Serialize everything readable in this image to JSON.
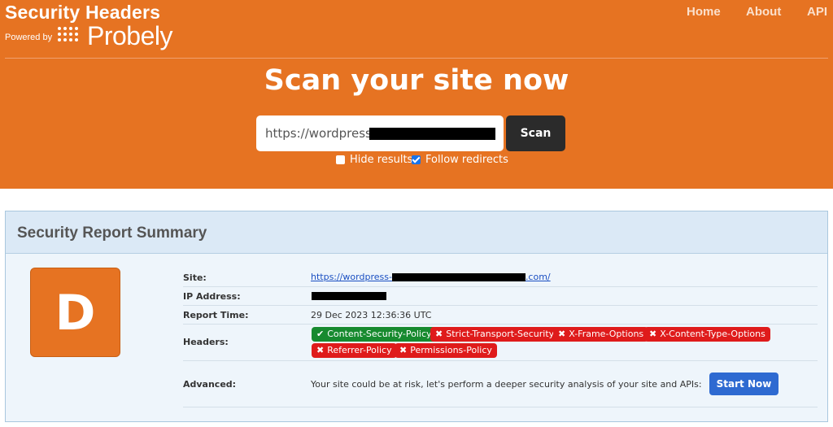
{
  "brand": {
    "title": "Security Headers",
    "powered_by": "Powered by",
    "logo_text": "Probely"
  },
  "nav": {
    "home": "Home",
    "about": "About",
    "api": "API"
  },
  "scan": {
    "title": "Scan your site now",
    "url_value": "https://wordpress-",
    "button_label": "Scan",
    "hide_results_label": "Hide results",
    "hide_results_checked": false,
    "follow_redirects_label": "Follow redirects",
    "follow_redirects_checked": true
  },
  "report": {
    "title": "Security Report Summary",
    "grade": "D",
    "grade_color": "#e67322",
    "rows": {
      "site_label": "Site:",
      "site_prefix": "https://wordpress-",
      "site_suffix": ".com/",
      "ip_label": "IP Address:",
      "time_label": "Report Time:",
      "time_value": "29 Dec 2023 12:36:36 UTC",
      "headers_label": "Headers:",
      "advanced_label": "Advanced:",
      "advanced_text": "Your site could be at risk, let's perform a deeper security analysis of your site and APIs:",
      "start_button": "Start Now"
    },
    "headers": {
      "csp": "Content-Security-Policy",
      "hsts": "Strict-Transport-Security",
      "xfo": "X-Frame-Options",
      "xcto": "X-Content-Type-Options",
      "referrer": "Referrer-Policy",
      "permissions": "Permissions-Policy"
    },
    "status_colors": {
      "pass": "#178a2f",
      "fail": "#df1b1b"
    }
  }
}
